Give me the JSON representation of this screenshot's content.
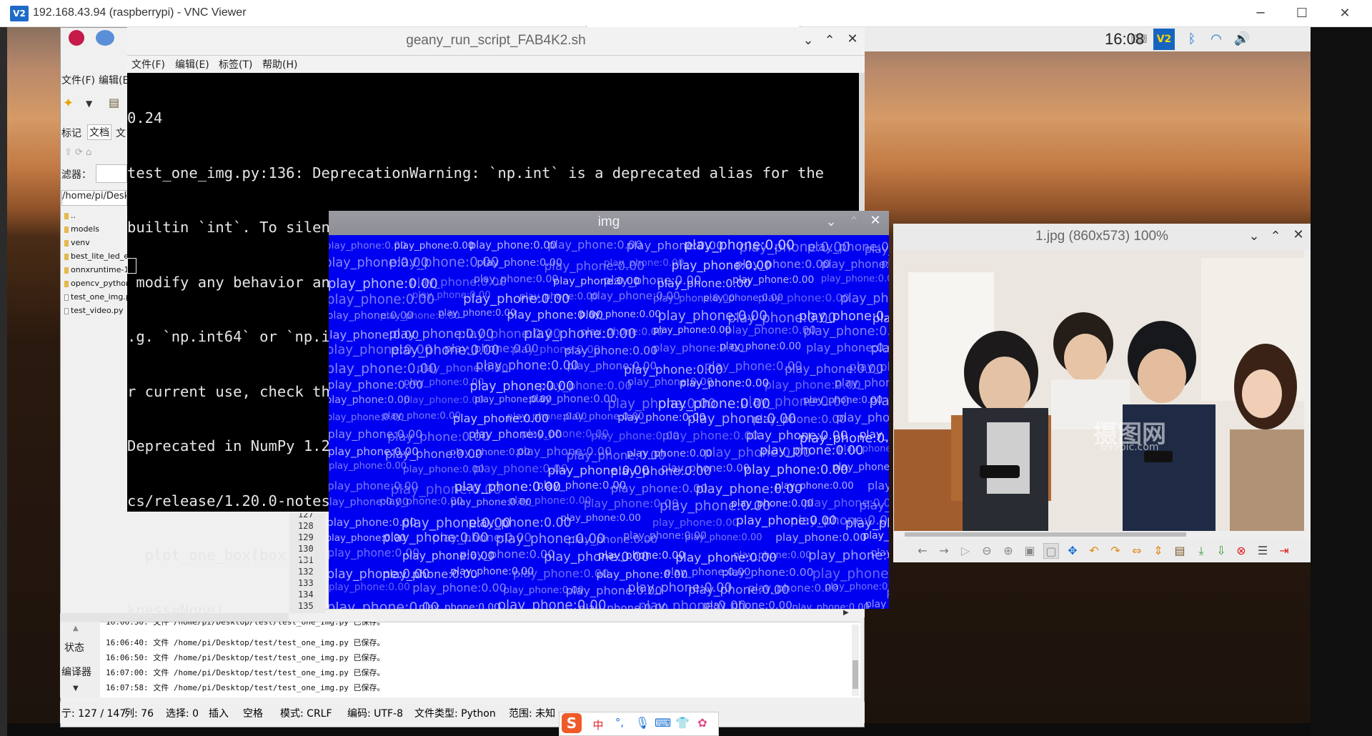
{
  "vnc": {
    "logo": "V2",
    "title": "192.168.43.94 (raspberrypi) - VNC Viewer",
    "minimize": "─",
    "maximize": "☐",
    "close": "✕"
  },
  "tray": {
    "clock": "16:08",
    "icons": [
      "keyboard-icon",
      "vnc-icon",
      "bluetooth-icon",
      "wifi-icon",
      "volume-icon"
    ]
  },
  "geany_bg": {
    "menu": [
      "文件(F)",
      "编辑(E"
    ],
    "tabs": [
      "标记",
      "文档",
      "文"
    ],
    "filter_label": "滤器：",
    "path": "/home/pi/Desk",
    "files": [
      "..",
      "models",
      "venv",
      "best_lite_led_e",
      "onnxruntime-1",
      "opencv_python",
      "test_one_img.p",
      "test_video.py"
    ],
    "line_numbers": [
      "128",
      "129",
      "130",
      "131",
      "132",
      "133",
      "134",
      "135"
    ],
    "line_partial": "127",
    "msg_tabs": [
      "状态",
      "编译器"
    ],
    "messages": [
      "16:06:30: 文件 /home/pi/Desktop/test/test_one_img.py 已保存。",
      "16:06:40: 文件 /home/pi/Desktop/test/test_one_img.py 已保存。",
      "16:06:50: 文件 /home/pi/Desktop/test/test_one_img.py 已保存。",
      "16:07:00: 文件 /home/pi/Desktop/test/test_one_img.py 已保存。",
      "16:07:58: 文件 /home/pi/Desktop/test/test_one_img.py 已保存。"
    ]
  },
  "status": {
    "line": "亍: 127 / 147",
    "col": "列: 76",
    "sel": "选择: 0",
    "insert": "插入",
    "indent": "空格",
    "mode": "模式: CRLF",
    "encoding": "编码: UTF-8",
    "filetype": "文件类型: Python",
    "scope": "范围: 未知"
  },
  "ime": {
    "logo": "S",
    "lang": "中",
    "punct": "°,",
    "items": [
      "mic-icon",
      "keyboard-icon",
      "shirt-icon",
      "apps-icon"
    ]
  },
  "terminal": {
    "title": "geany_run_script_FAB4K2.sh",
    "menu": [
      "文件(F)",
      "编辑(E)",
      "标签(T)",
      "帮助(H)"
    ],
    "lines": [
      "0.24",
      "test_one_img.py:136: DeprecationWarning: `np.int` is a deprecated alias for the",
      "builtin `int`. To silence this warning, use `int` by itself. Doing this will not",
      " modify any behavior and is safe. When replacing `np.int`, you may wish to use e",
      ".g. `np.int64` or `np.int32` to specify the precision. If you wish to review you",
      "r current use, check the release note link for additional information.",
      "Deprecated in NumPy 1.20; for more details and guidance: https://numpy.org/devdo",
      "cs/release/1.20.0-notes.html#deprecations",
      "  plot_one_box(box.ast",
      "kness=None)"
    ]
  },
  "img_window": {
    "title": "img",
    "noise_text": "play_phone:0.00"
  },
  "viewer": {
    "title": "1.jpg (860x573) 100%",
    "watermark": "摄图网",
    "watermark_sub": "699pic.com"
  }
}
